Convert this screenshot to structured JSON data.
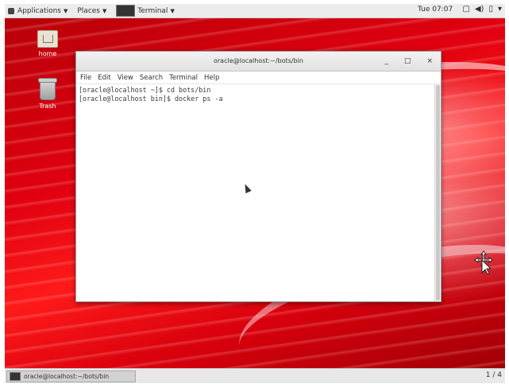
{
  "topbar": {
    "applications": "Applications",
    "places": "Places",
    "terminal": "Terminal",
    "clock": "Tue 07:07",
    "icons": [
      "display-icon",
      "volume-icon",
      "battery-icon",
      "power-menu-icon"
    ]
  },
  "desktop": {
    "icons": [
      {
        "label": "home",
        "icon": "home-folder-icon"
      },
      {
        "label": "Trash",
        "icon": "trash-icon"
      }
    ]
  },
  "window": {
    "title": "oracle@localhost:~/bots/bin",
    "controls": {
      "minimize": "_",
      "maximize": "□",
      "close": "×"
    },
    "menu": [
      "File",
      "Edit",
      "View",
      "Search",
      "Terminal",
      "Help"
    ],
    "lines": [
      "[oracle@localhost ~]$ cd bots/bin",
      "[oracle@localhost bin]$ docker ps -a"
    ]
  },
  "taskbar": {
    "task_label": "oracle@localhost:~/bots/bin",
    "workspace": "1 / 4"
  },
  "colors": {
    "desktop_red": "#e0000f",
    "panel": "#ececec"
  }
}
